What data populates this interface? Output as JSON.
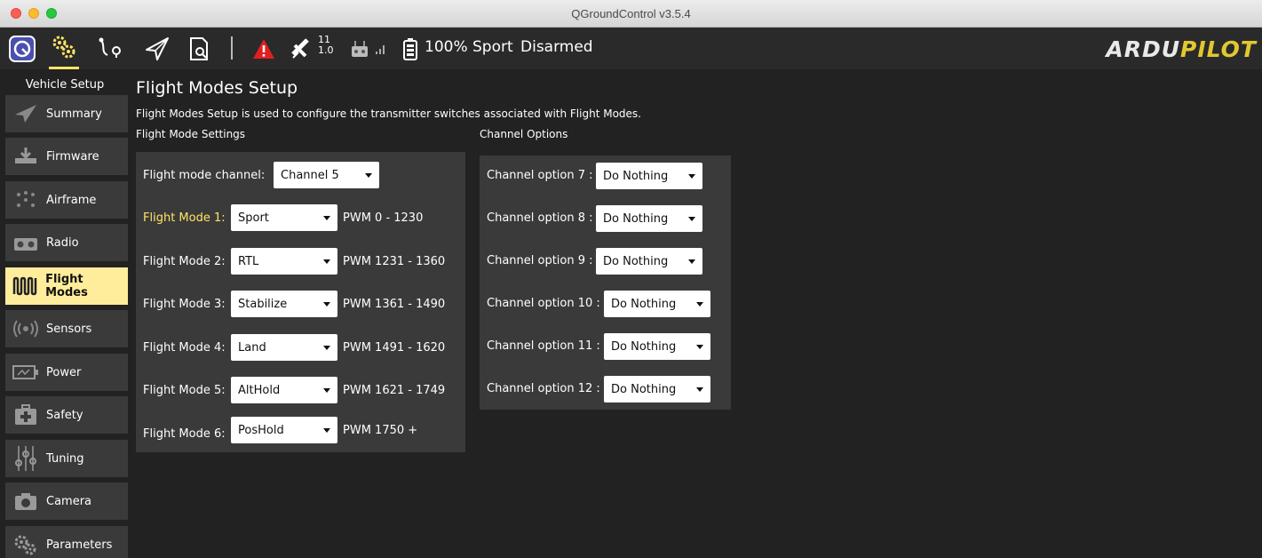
{
  "window": {
    "title": "QGroundControl v3.5.4"
  },
  "toolbar": {
    "satellite_count": "11",
    "hdop": "1.0",
    "battery": "100%",
    "flight_mode": "Sport",
    "arm_state": "Disarmed",
    "logo_part1": "ARDU",
    "logo_part2": "PILOT"
  },
  "sidebar": {
    "header": "Vehicle Setup",
    "items": [
      {
        "label": "Summary",
        "icon": "paper-plane-icon"
      },
      {
        "label": "Firmware",
        "icon": "download-icon"
      },
      {
        "label": "Airframe",
        "icon": "airframe-icon"
      },
      {
        "label": "Radio",
        "icon": "radio-icon"
      },
      {
        "label": "Flight Modes",
        "icon": "flight-modes-icon",
        "active": true
      },
      {
        "label": "Sensors",
        "icon": "sensors-icon"
      },
      {
        "label": "Power",
        "icon": "battery-icon"
      },
      {
        "label": "Safety",
        "icon": "first-aid-icon"
      },
      {
        "label": "Tuning",
        "icon": "sliders-icon"
      },
      {
        "label": "Camera",
        "icon": "camera-icon"
      },
      {
        "label": "Parameters",
        "icon": "gears-icon"
      }
    ]
  },
  "main": {
    "title": "Flight Modes Setup",
    "description": "Flight Modes Setup is used to configure the transmitter switches associated with Flight Modes.",
    "flight_mode_settings": {
      "title": "Flight Mode Settings",
      "channel_label": "Flight mode channel:",
      "channel_value": "Channel 5",
      "modes": [
        {
          "label": "Flight Mode 1:",
          "value": "Sport",
          "pwm": "PWM 0 - 1230",
          "highlight": true
        },
        {
          "label": "Flight Mode 2:",
          "value": "RTL",
          "pwm": "PWM 1231 - 1360"
        },
        {
          "label": "Flight Mode 3:",
          "value": "Stabilize",
          "pwm": "PWM 1361 - 1490"
        },
        {
          "label": "Flight Mode 4:",
          "value": "Land",
          "pwm": "PWM 1491 - 1620"
        },
        {
          "label": "Flight Mode 5:",
          "value": "AltHold",
          "pwm": "PWM 1621 - 1749"
        },
        {
          "label": "Flight Mode 6:",
          "value": "PosHold",
          "pwm": "PWM 1750 +"
        }
      ]
    },
    "channel_options": {
      "title": "Channel Options",
      "options": [
        {
          "label": "Channel option 7 :",
          "value": "Do Nothing"
        },
        {
          "label": "Channel option 8 :",
          "value": "Do Nothing"
        },
        {
          "label": "Channel option 9 :",
          "value": "Do Nothing"
        },
        {
          "label": "Channel option 10 :",
          "value": "Do Nothing"
        },
        {
          "label": "Channel option 11 :",
          "value": "Do Nothing"
        },
        {
          "label": "Channel option 12 :",
          "value": "Do Nothing"
        }
      ]
    }
  },
  "colors": {
    "accent": "#ffe566",
    "active_sidebar": "#ffed9b",
    "panel": "#3a3a3a",
    "background": "#222222",
    "warning": "#e02020"
  }
}
